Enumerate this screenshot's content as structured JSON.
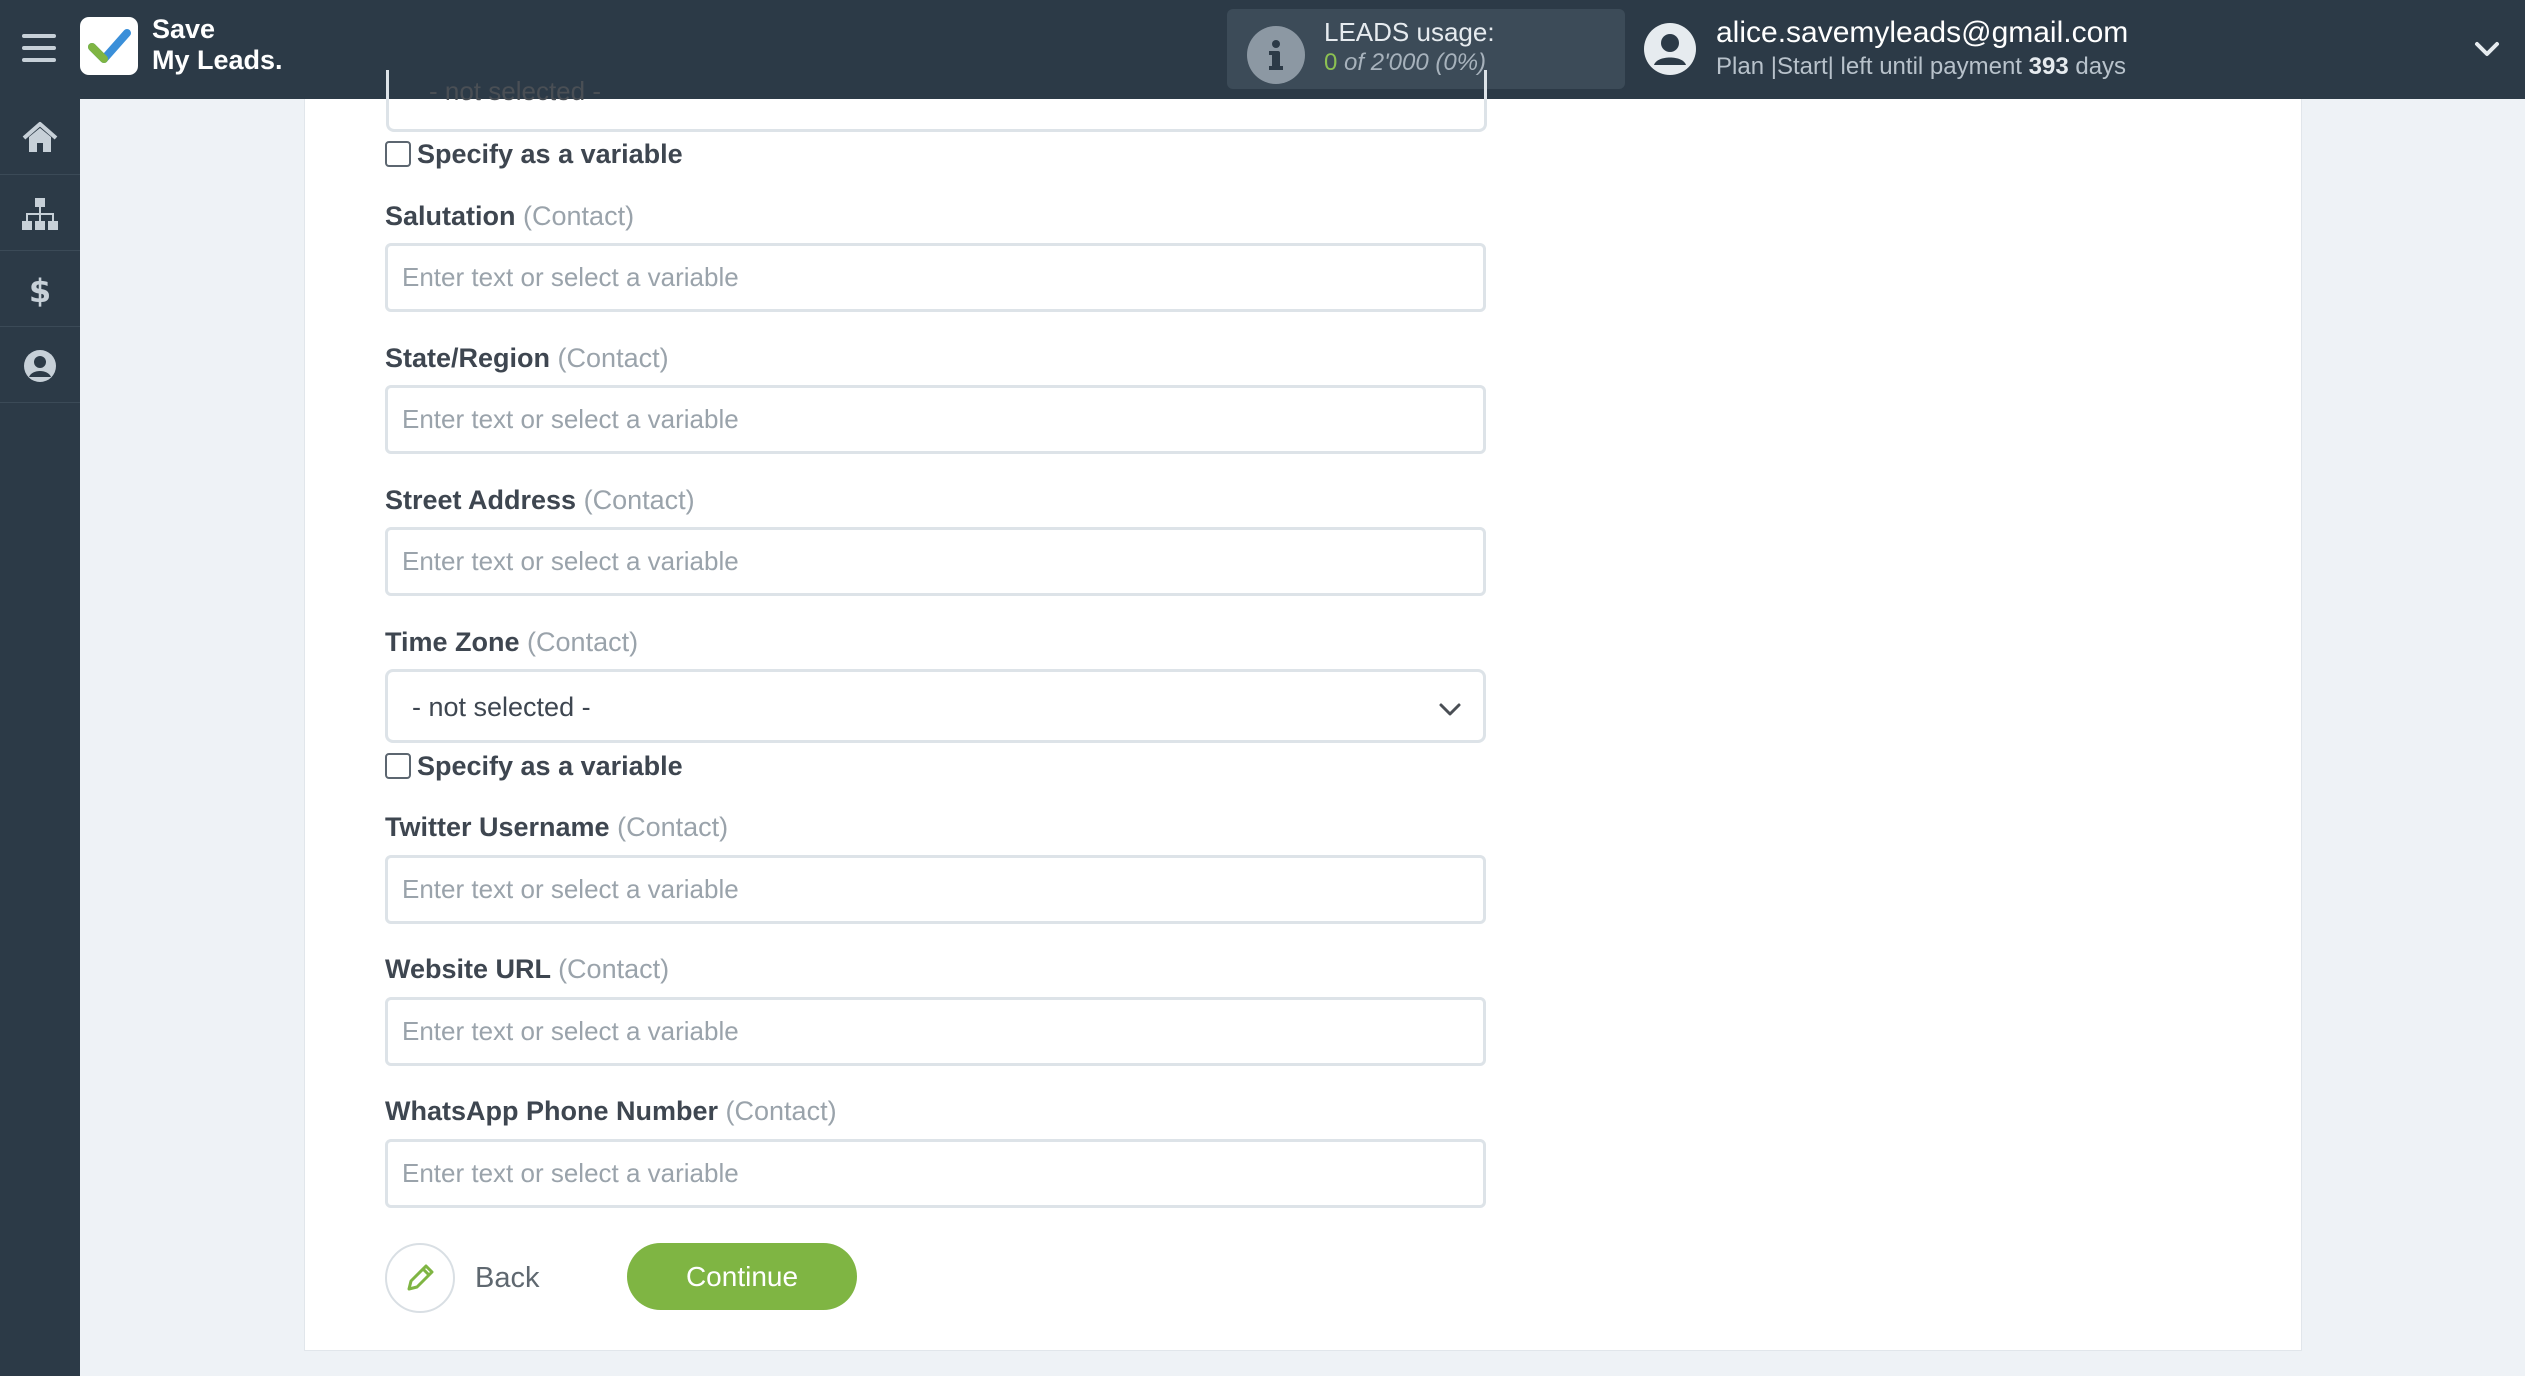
{
  "app": {
    "logo_line1": "Save",
    "logo_line2": "My Leads."
  },
  "leads_usage": {
    "title": "LEADS usage:",
    "used": "0",
    "of_text": "of 2'000",
    "percent": "(0%)"
  },
  "account": {
    "email": "alice.savemyleads@gmail.com",
    "plan_prefix": "Plan |Start| left until payment",
    "days_left": "393",
    "days_suffix": "days"
  },
  "sidebar": {
    "items": [
      {
        "icon": "home-icon"
      },
      {
        "icon": "sitemap-icon"
      },
      {
        "icon": "dollar-icon"
      },
      {
        "icon": "user-icon"
      }
    ]
  },
  "form": {
    "top_select_partial_value": "- not selected -",
    "checkbox_label": "Specify as a variable",
    "context_label": "(Contact)",
    "placeholder": "Enter text or select a variable",
    "fields": {
      "salutation": "Salutation",
      "state_region": "State/Region",
      "street_address": "Street Address",
      "time_zone": "Time Zone",
      "twitter_username": "Twitter Username",
      "website_url": "Website URL",
      "whatsapp_phone": "WhatsApp Phone Number"
    },
    "time_zone_value": "- not selected -"
  },
  "buttons": {
    "back": "Back",
    "continue": "Continue"
  },
  "colors": {
    "topbar": "#2c3a47",
    "accent_green": "#7fb543",
    "usage_green": "#8cc152"
  }
}
